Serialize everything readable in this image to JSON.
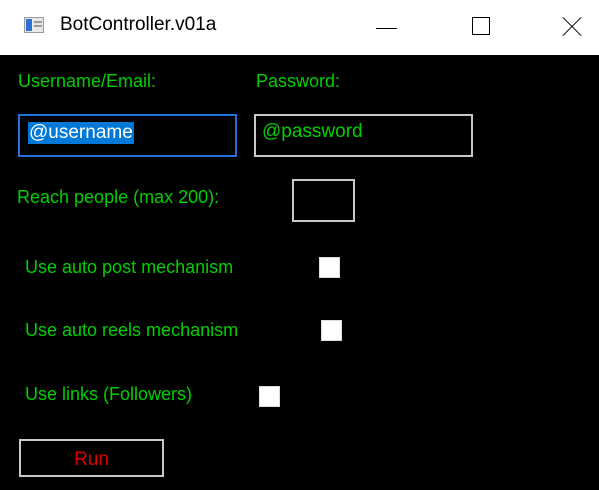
{
  "window": {
    "title": "BotController.v01a",
    "icon": "app-window-icon",
    "controls": {
      "minimize": "minimize-icon",
      "maximize": "maximize-icon",
      "close": "close-icon"
    }
  },
  "form": {
    "username_label": "Username/Email:",
    "password_label": "Password:",
    "username_value": "@username",
    "password_value": "@password",
    "reach_label": "Reach people (max 200):",
    "reach_value": "",
    "auto_post_label": "Use auto post mechanism",
    "auto_post_checked": false,
    "auto_reels_label": "Use auto reels mechanism",
    "auto_reels_checked": false,
    "use_links_label": "Use links (Followers)",
    "use_links_checked": false,
    "run_label": "Run"
  },
  "colors": {
    "background": "#000000",
    "label_text": "#00d000",
    "run_text": "#e00000",
    "focus_border": "#1e72d8",
    "selection": "#0078d7"
  }
}
